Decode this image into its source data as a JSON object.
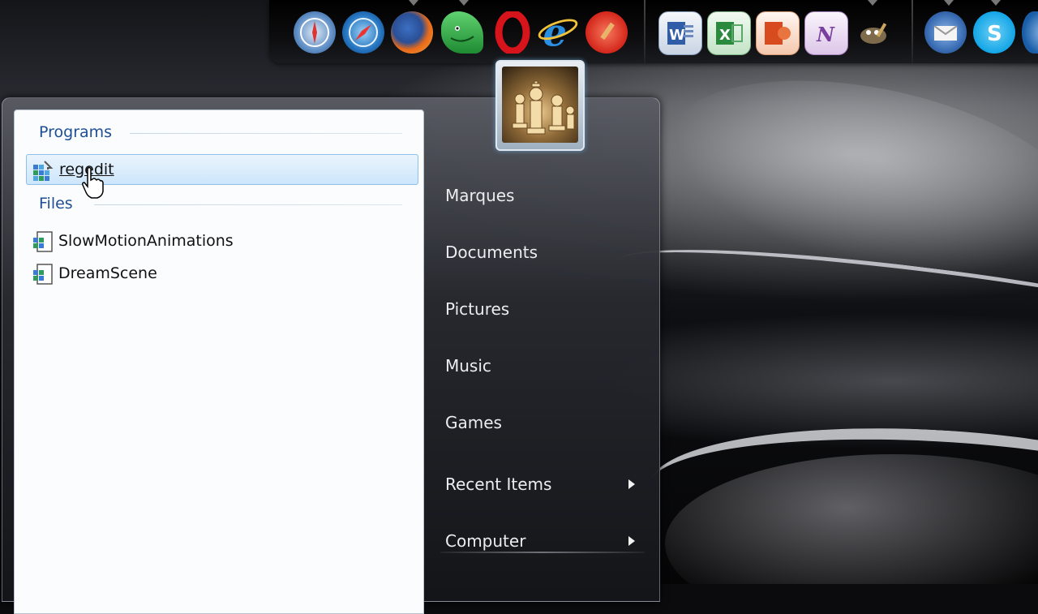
{
  "dock": {
    "icons": [
      {
        "name": "safari-compass-icon",
        "color": "#3b7fd0"
      },
      {
        "name": "safari-icon",
        "color": "#1c6fb8"
      },
      {
        "name": "firefox-icon",
        "color": "#e86a1a"
      },
      {
        "name": "dragon-icon",
        "color": "#2fa843"
      },
      {
        "name": "opera-icon",
        "color": "#d7141b"
      },
      {
        "name": "internet-explorer-icon",
        "color": "#2a8fe0"
      },
      {
        "name": "ccleaner-icon",
        "color": "#e0371f"
      },
      {
        "name": "word-icon",
        "color": "#2f5da8"
      },
      {
        "name": "excel-icon",
        "color": "#2a8b3e"
      },
      {
        "name": "powerpoint-icon",
        "color": "#d84b1e"
      },
      {
        "name": "onenote-icon",
        "color": "#7a3f9e"
      },
      {
        "name": "gimp-icon",
        "color": "#6a5a3c"
      },
      {
        "name": "thunderbird-icon",
        "color": "#3a6db4"
      },
      {
        "name": "skype-icon",
        "color": "#12a5e6"
      },
      {
        "name": "extra-app-icon",
        "color": "#1a5ea8"
      }
    ]
  },
  "start_menu": {
    "user_tile_icon": "chess-pieces-icon",
    "left": {
      "programs_header": "Programs",
      "files_header": "Files",
      "programs": [
        {
          "label": "regedit",
          "icon": "regedit-icon",
          "selected": true
        }
      ],
      "files": [
        {
          "label": "SlowMotionAnimations",
          "icon": "registry-file-icon"
        },
        {
          "label": "DreamScene",
          "icon": "registry-file-icon"
        }
      ]
    },
    "right": {
      "items": [
        "Marques",
        "Documents",
        "Pictures",
        "Music",
        "Games"
      ],
      "submenu_items": [
        "Recent Items",
        "Computer"
      ]
    }
  },
  "colors": {
    "section_header": "#1e4f94",
    "selection_bg": "#cde6fb",
    "right_text": "#ecedf0"
  }
}
